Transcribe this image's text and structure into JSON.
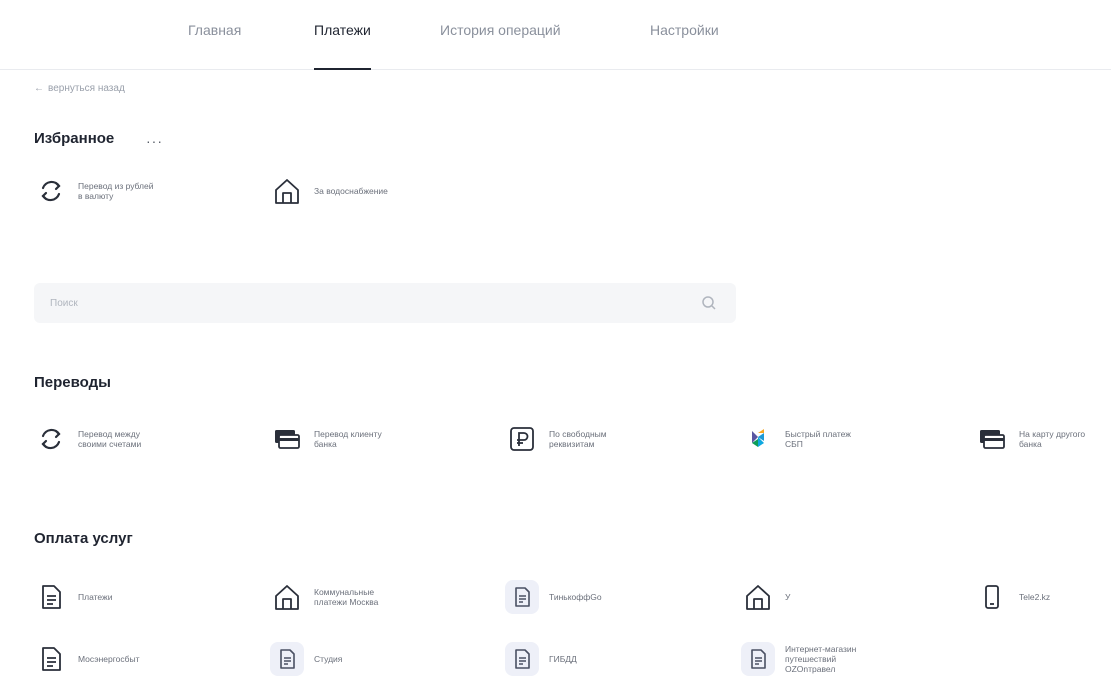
{
  "nav": {
    "tabs": [
      {
        "label": "Главная"
      },
      {
        "label": "Платежи"
      },
      {
        "label": "История операций"
      },
      {
        "label": "Настройки"
      }
    ]
  },
  "back_link": "вернуться назад",
  "favorites": {
    "title": "Избранное",
    "more": "···",
    "items": [
      {
        "label": "Перевод из рублей в валюту",
        "icon": "refresh-arrows-icon"
      },
      {
        "label": "За водоснабжение",
        "icon": "house-icon"
      }
    ]
  },
  "search": {
    "placeholder": "Поиск",
    "icon": "search-icon"
  },
  "transfers": {
    "title": "Переводы",
    "items": [
      {
        "label": "Перевод между своими счетами",
        "icon": "refresh-arrows-icon"
      },
      {
        "label": "Перевод клиенту банка",
        "icon": "cards-icon"
      },
      {
        "label": "По свободным реквизитам",
        "icon": "ruble-icon"
      },
      {
        "label": "Быстрый платеж СБП",
        "icon": "sbp-icon"
      },
      {
        "label": "На карту другого банка",
        "icon": "cards-icon"
      }
    ]
  },
  "services": {
    "title": "Оплата услуг",
    "items": [
      {
        "label": "Платежи",
        "icon": "document-icon"
      },
      {
        "label": "Коммунальные платежи Москва",
        "icon": "house-icon"
      },
      {
        "label": "ТинькоффGo",
        "icon": "document-icon"
      },
      {
        "label": "У",
        "icon": "house-icon"
      },
      {
        "label": "Tele2.kz",
        "icon": "phone-icon"
      },
      {
        "label": "Мосэнергосбыт",
        "icon": "document-icon"
      },
      {
        "label": "Студия",
        "icon": "document-icon"
      },
      {
        "label": "ГИБДД",
        "icon": "document-icon"
      },
      {
        "label": "Интернет-магазин путешествий OZOnтравел",
        "icon": "document-icon"
      }
    ]
  }
}
